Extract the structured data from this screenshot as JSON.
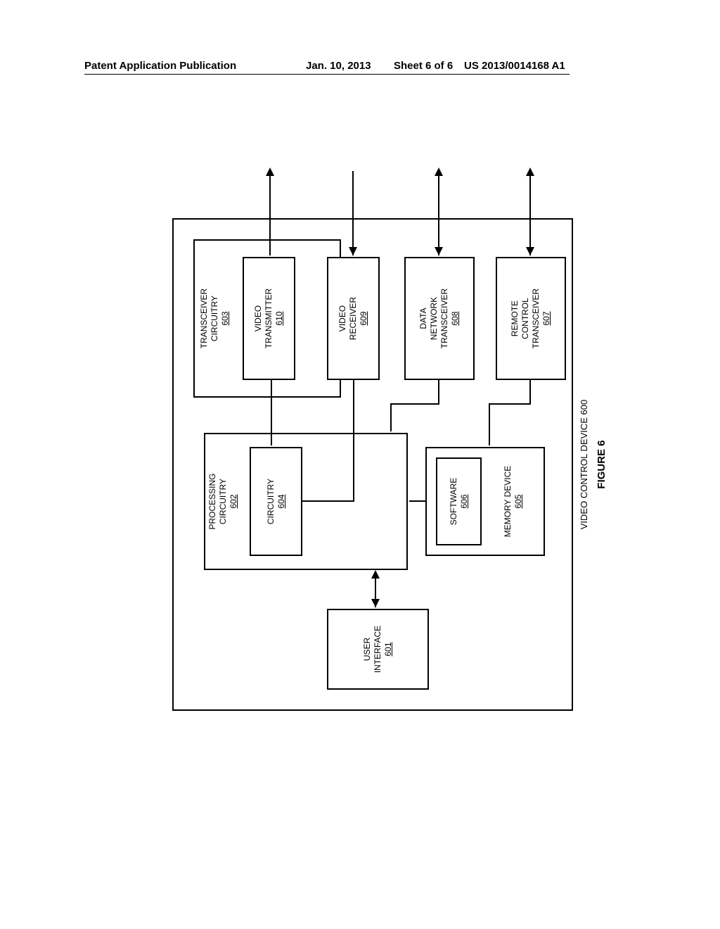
{
  "header": {
    "left": "Patent Application Publication",
    "mid_date": "Jan. 10, 2013",
    "mid_sheet": "Sheet 6 of 6",
    "right": "US 2013/0014168 A1"
  },
  "diagram": {
    "outer_label": "VIDEO CONTROL DEVICE 600",
    "figure_label": "FIGURE 6",
    "user_interface": {
      "name": "USER\nINTERFACE",
      "ref": "601"
    },
    "processing": {
      "name": "PROCESSING\nCIRCUITRY",
      "ref": "602"
    },
    "circuitry": {
      "name": "CIRCUITRY",
      "ref": "604"
    },
    "memory": {
      "name": "MEMORY DEVICE",
      "ref": "605"
    },
    "software": {
      "name": "SOFTWARE",
      "ref": "606"
    },
    "transceiver": {
      "name": "TRANSCEIVER\nCIRCUITRY",
      "ref": "603"
    },
    "video_tx": {
      "name": "VIDEO\nTRANSMITTER",
      "ref": "610"
    },
    "video_rx": {
      "name": "VIDEO\nRECEIVER",
      "ref": "609"
    },
    "data_net": {
      "name": "DATA\nNETWORK\nTRANSCEIVER",
      "ref": "608"
    },
    "remote": {
      "name": "REMOTE\nCONTROL\nTRANSCEIVER",
      "ref": "607"
    }
  }
}
